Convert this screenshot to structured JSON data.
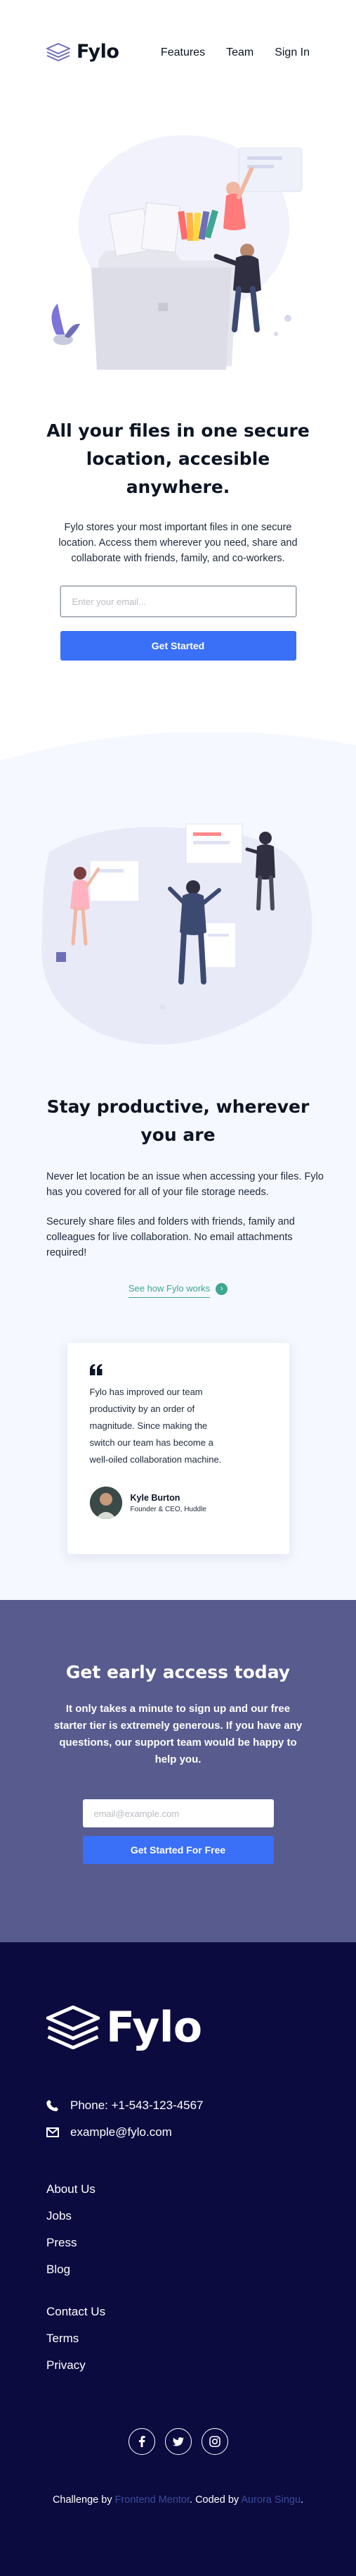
{
  "brand": {
    "name": "Fylo"
  },
  "nav": {
    "features": "Features",
    "team": "Team",
    "signin": "Sign In"
  },
  "hero": {
    "title": "All your files in one secure location, accesible anywhere.",
    "text": "Fylo stores your most important files in one secure location. Access them wherever you need, share and collaborate with friends, family, and co-workers.",
    "email_placeholder": "Enter your email...",
    "cta": "Get Started"
  },
  "productive": {
    "title": "Stay productive, wherever you are",
    "paragraph1": "Never let location be an issue when accessing your files. Fylo has you covered for all of your file storage needs.",
    "paragraph2": "Securely share files and folders with friends, family and colleagues for live collaboration. No email attachments required!",
    "link": "See how Fylo works"
  },
  "testimonial": {
    "quote": "Fylo has improved our team productivity by an order of magnitude. Since making the switch our team has become a well-oiled collaboration machine.",
    "name": "Kyle Burton",
    "role": "Founder & CEO, Huddle"
  },
  "early_access": {
    "title": "Get early access today",
    "text": "It only takes a minute to sign up and our free starter tier is extremely generous. If you have any questions, our support team would be happy to help you.",
    "email_placeholder": "email@example.com",
    "cta": "Get Started For Free"
  },
  "footer": {
    "phone": "Phone: +1-543-123-4567",
    "email": "example@fylo.com",
    "links1": [
      "About Us",
      "Jobs",
      "Press",
      "Blog"
    ],
    "links2": [
      "Contact Us",
      "Terms",
      "Privacy"
    ],
    "socials": [
      "facebook-icon",
      "twitter-icon",
      "instagram-icon"
    ],
    "attribution_prefix": "Challenge by ",
    "attribution_link1": "Frontend Mentor",
    "attribution_middle": ". Coded by ",
    "attribution_link2": "Aurora Singu",
    "attribution_suffix": "."
  },
  "colors": {
    "accent_blue": "#3a6ff7",
    "teal": "#3ea691",
    "early_bg": "#585b8e",
    "footer_bg": "#0c0b3f",
    "section_bg": "#f6f8ff"
  }
}
